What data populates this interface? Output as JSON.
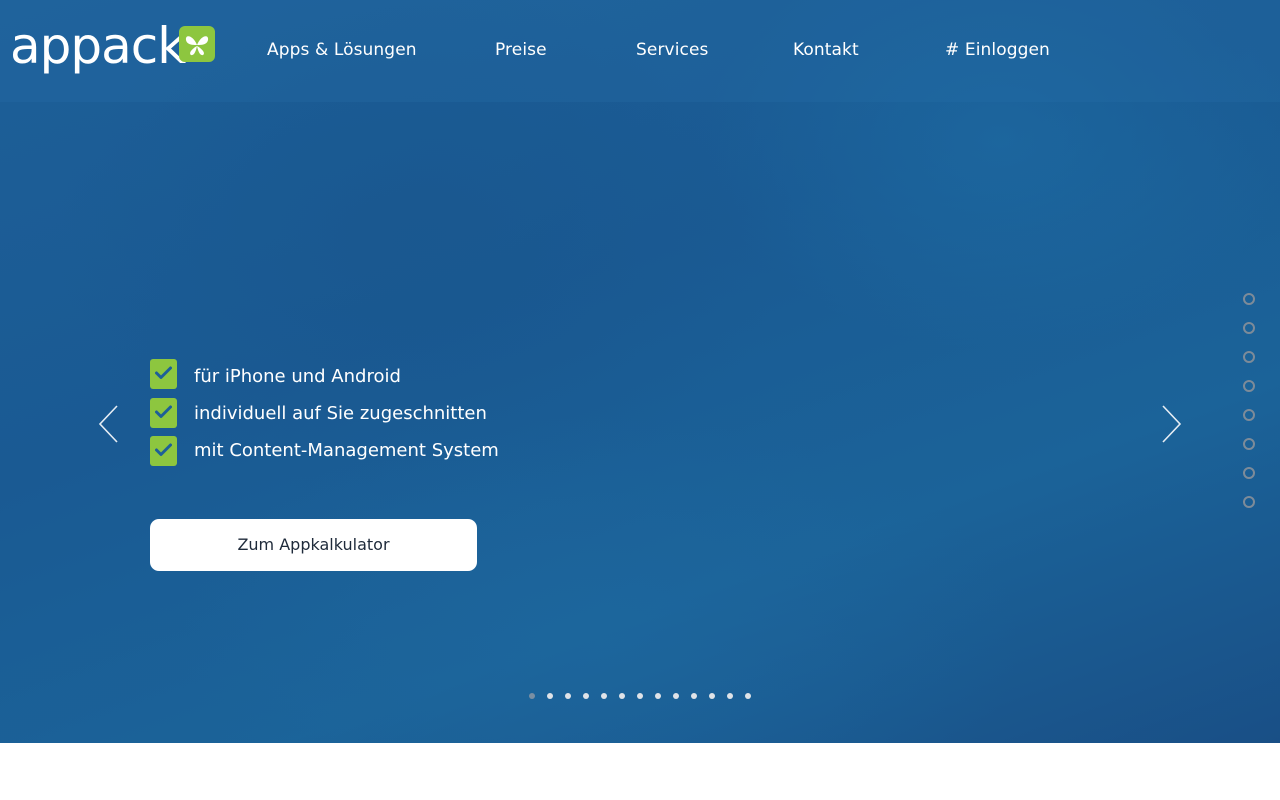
{
  "brand": {
    "logo_text": "appack",
    "accent_color": "#8dc63f",
    "hero_color": "#1d5f98"
  },
  "nav": {
    "items": [
      {
        "label": "Apps & Lösungen"
      },
      {
        "label": "Preise"
      },
      {
        "label": "Services"
      },
      {
        "label": "Kontakt"
      },
      {
        "label": "# Einloggen"
      }
    ]
  },
  "hero": {
    "features": [
      {
        "text": "für iPhone und Android",
        "icon": "check-icon"
      },
      {
        "text": "individuell auf Sie zugeschnitten",
        "icon": "check-icon"
      },
      {
        "text": "mit Content-Management System",
        "icon": "check-icon"
      }
    ],
    "cta_label": "Zum Appkalkulator",
    "prev_icon": "chevron-left-icon",
    "next_icon": "chevron-right-icon"
  },
  "side_navigation": {
    "count": 8,
    "active_index": -1
  },
  "slider": {
    "count": 13,
    "active_index": 0
  }
}
